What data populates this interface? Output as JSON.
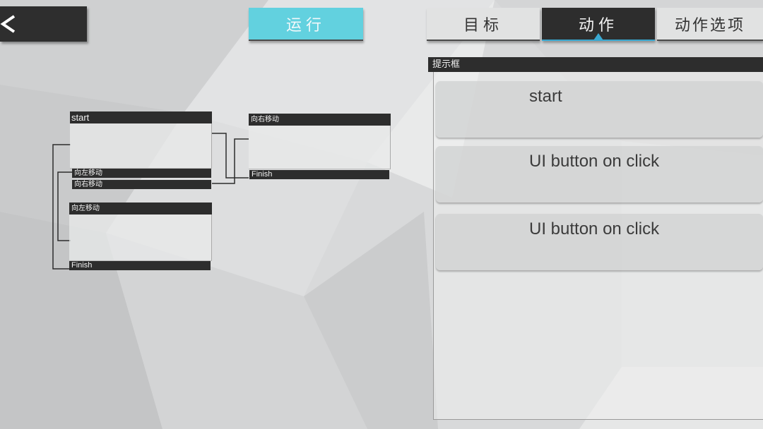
{
  "header": {
    "run_label": "运行",
    "tabs": [
      {
        "label": "目标",
        "active": false
      },
      {
        "label": "动作",
        "active": true
      },
      {
        "label": "动作选项",
        "active": false
      }
    ]
  },
  "graph": {
    "nodes": [
      {
        "title": "start",
        "ports": [
          "向左移动",
          "向右移动"
        ]
      },
      {
        "title": "向右移动",
        "ports": [
          "Finish"
        ]
      },
      {
        "title": "向左移动",
        "ports": [
          "Finish"
        ]
      }
    ]
  },
  "panel": {
    "title": "提示框",
    "actions": [
      "start",
      "UI button on click",
      "UI button on click"
    ]
  },
  "colors": {
    "accent": "#62d1df",
    "dark": "#2d2d2d",
    "active_underline": "#3aa8d0"
  },
  "icons": {
    "back": "chevron-left-icon",
    "tab_active_indicator": "caret-up-icon"
  }
}
